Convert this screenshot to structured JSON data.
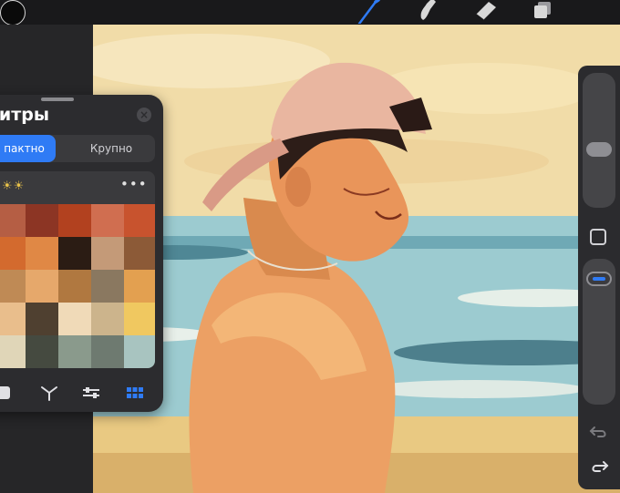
{
  "toolbar": {
    "tools": [
      {
        "name": "brush-icon",
        "color": "#2f7bf5"
      },
      {
        "name": "smudge-icon",
        "color": "#d8d8d8"
      },
      {
        "name": "eraser-icon",
        "color": "#d8d8d8"
      },
      {
        "name": "layers-icon",
        "color": "#d8d8d8"
      }
    ],
    "current_color": "#0a0a0a"
  },
  "palette_panel": {
    "title": "литры",
    "view_modes": [
      "пактно",
      "Крупно"
    ],
    "selected_view": "пактно",
    "palette_name": "☀☀",
    "more_label": "•••",
    "swatches": [
      "#b55e44",
      "#8c3524",
      "#b2411f",
      "#d06e50",
      "#c8532e",
      "#d36a2e",
      "#e08845",
      "#2b1c14",
      "#c49a78",
      "#8c5a37",
      "#bf8a55",
      "#e6a86b",
      "#b07840",
      "#8a7860",
      "#e3a050",
      "#e9be8c",
      "#4f4030",
      "#f0dab8",
      "#ccb48c",
      "#f0c860",
      "#e0d6b8",
      "#454a40",
      "#8a9a8c",
      "#6e7a70",
      "#a8c4c0"
    ],
    "bottom_tabs": [
      "square-icon",
      "harmony-icon",
      "sliders-icon",
      "palette-grid-icon"
    ]
  },
  "sidebar": {
    "brush_size": 0.45,
    "opacity": 0.9,
    "undo_icon": "undo-icon",
    "redo_icon": "redo-icon"
  },
  "colors": {
    "accent": "#2f7bf5",
    "panel": "#2c2c2f",
    "toolbar": "#19191b"
  }
}
